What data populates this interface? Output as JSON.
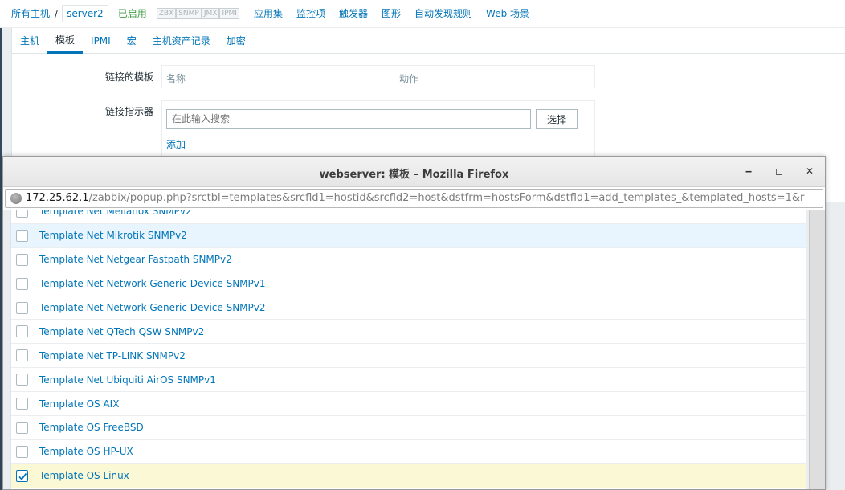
{
  "breadcrumb": {
    "all_hosts": "所有主机",
    "separator": "/",
    "current_host": "server2"
  },
  "host_status": {
    "enabled_label": "已启用",
    "color": "#429e47"
  },
  "availability": [
    "ZBX",
    "SNMP",
    "JMX",
    "IPMI"
  ],
  "host_nav": [
    "应用集",
    "监控项",
    "触发器",
    "图形",
    "自动发现规则",
    "Web 场景"
  ],
  "tabs": [
    {
      "label": "主机",
      "active": false
    },
    {
      "label": "模板",
      "active": true
    },
    {
      "label": "IPMI",
      "active": false
    },
    {
      "label": "宏",
      "active": false
    },
    {
      "label": "主机资产记录",
      "active": false
    },
    {
      "label": "加密",
      "active": false
    }
  ],
  "form": {
    "linked_templates_label": "链接的模板",
    "col_name": "名称",
    "col_action": "动作",
    "link_indicator_label": "链接指示器",
    "search_placeholder": "在此输入搜索",
    "select_button": "选择",
    "add_link": "添加"
  },
  "popup": {
    "window_title": "webserver: 模板 – Mozilla Firefox",
    "url_host": "172.25.62.1",
    "url_path": "/zabbix/popup.php?srctbl=templates&srcfld1=hostid&srcfld2=host&dstfrm=hostsForm&dstfld1=add_templates_&templated_hosts=1&r",
    "templates": [
      {
        "name": "Template Net Mellanox SNMPv2",
        "checked": false
      },
      {
        "name": "Template Net Mikrotik SNMPv2",
        "checked": false,
        "hover": true
      },
      {
        "name": "Template Net Netgear Fastpath SNMPv2",
        "checked": false
      },
      {
        "name": "Template Net Network Generic Device SNMPv1",
        "checked": false
      },
      {
        "name": "Template Net Network Generic Device SNMPv2",
        "checked": false
      },
      {
        "name": "Template Net QTech QSW SNMPv2",
        "checked": false
      },
      {
        "name": "Template Net TP-LINK SNMPv2",
        "checked": false
      },
      {
        "name": "Template Net Ubiquiti AirOS SNMPv1",
        "checked": false
      },
      {
        "name": "Template OS AIX",
        "checked": false
      },
      {
        "name": "Template OS FreeBSD",
        "checked": false
      },
      {
        "name": "Template OS HP-UX",
        "checked": false
      },
      {
        "name": "Template OS Linux",
        "checked": true
      },
      {
        "name": "",
        "checked": false
      }
    ]
  },
  "colors": {
    "link": "#0275b8",
    "checked_row": "#fbf8d6",
    "hover_row": "#e8f5ff"
  }
}
